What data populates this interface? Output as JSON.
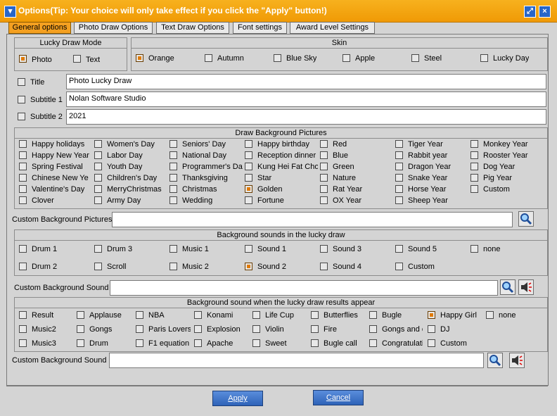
{
  "window": {
    "title": "Options(Tip: Your choice will only take effect if you click the \"Apply\" button!)"
  },
  "tabs": [
    "General options",
    "Photo Draw Options",
    "Text Draw Options",
    "Font settings",
    "Award Level Settings"
  ],
  "lucky_draw_mode": {
    "header": "Lucky Draw Mode",
    "photo": "Photo",
    "text": "Text"
  },
  "skin": {
    "header": "Skin",
    "options": [
      "Orange",
      "Autumn",
      "Blue Sky",
      "Apple",
      "Steel",
      "Lucky Day"
    ]
  },
  "titles": {
    "title_label": "Title",
    "title_value": "Photo Lucky Draw",
    "subtitle1_label": "Subtitle 1",
    "subtitle1_value": "Nolan  Software Studio",
    "subtitle2_label": "Subtitle 2",
    "subtitle2_value": "2021"
  },
  "bg_pictures": {
    "header": "Draw Background Pictures",
    "columns": [
      [
        "Happy holidays",
        "Happy New Year",
        "Spring Festival",
        "Chinese New Ye",
        "Valentine's Day",
        "Clover"
      ],
      [
        "Women's Day",
        "Labor Day",
        "Youth Day",
        "Children's Day",
        "MerryChristmas",
        "Army Day"
      ],
      [
        "Seniors' Day",
        "National Day",
        "Programmer's Da",
        "Thanksgiving",
        "Christmas",
        "Wedding"
      ],
      [
        "Happy birthday",
        "Reception dinner",
        "Kung Hei Fat Cho",
        "Star",
        "Golden",
        "Fortune"
      ],
      [
        "Red",
        "Blue",
        "Green",
        "Nature",
        "Rat Year",
        "OX Year"
      ],
      [
        "Tiger Year",
        "Rabbit year",
        "Dragon Year",
        "Snake Year",
        "Horse Year",
        "Sheep Year"
      ],
      [
        "Monkey Year",
        "Rooster Year",
        "Dog Year",
        "Pig Year",
        "Custom"
      ]
    ],
    "custom_label": "Custom Background Pictures"
  },
  "bg_sounds": {
    "header": "Background sounds in the lucky draw",
    "row1": [
      "Drum 1",
      "Drum 3",
      "Music 1",
      "Sound 1",
      "Sound 3",
      "Sound 5",
      "none"
    ],
    "row2": [
      "Drum 2",
      "Scroll",
      "Music 2",
      "Sound 2",
      "Sound 4",
      "Custom"
    ],
    "custom_label": "Custom Background Sound"
  },
  "result_sounds": {
    "header": "Background sound when the lucky draw results appear",
    "row1": [
      "Result",
      "Applause",
      "NBA",
      "Konami",
      "Life Cup",
      "Butterflies",
      "Bugle",
      "Happy Girl",
      "none"
    ],
    "row2": [
      "Music2",
      "Gongs",
      "Paris Lovers",
      "Explosion",
      "Violin",
      "Fire",
      "Gongs and c",
      "DJ"
    ],
    "row3": [
      "Music3",
      "Drum",
      "F1 equation",
      "Apache",
      "Sweet",
      "Bugle call",
      "Congratulati",
      "Custom"
    ],
    "custom_label": "Custom Background Sound"
  },
  "buttons": {
    "apply": "Apply",
    "cancel": "Cancel"
  },
  "colors": {
    "titlebar": "#f4a019",
    "active_tab": "#f4a021",
    "button": "#2e63b8",
    "check_mark": "#e07a00"
  }
}
